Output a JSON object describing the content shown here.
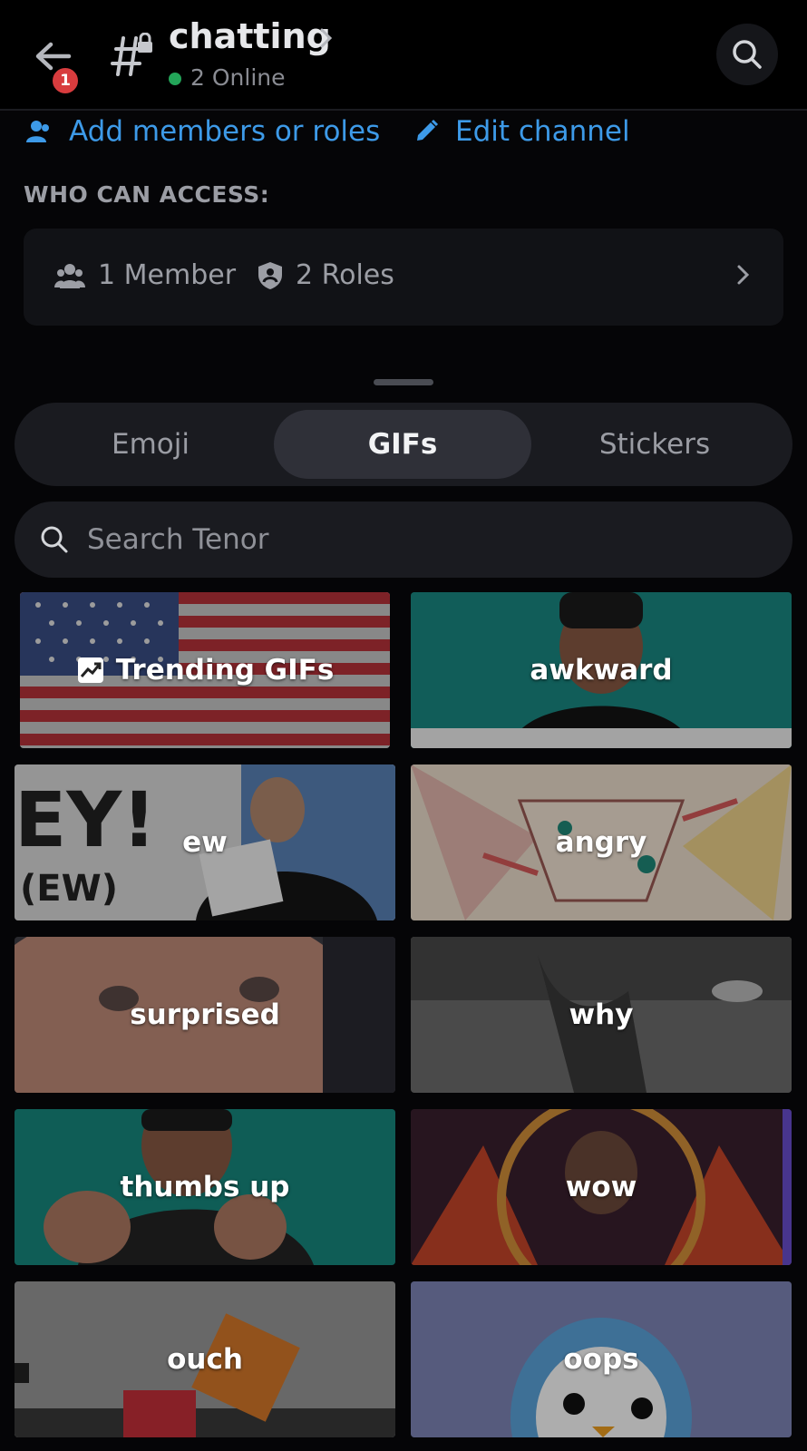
{
  "header": {
    "back_badge": "1",
    "channel_name": "chatting",
    "online_status": "2 Online"
  },
  "links": {
    "add_members": "Add members or roles",
    "edit_channel": "Edit channel"
  },
  "access": {
    "heading": "WHO CAN ACCESS:",
    "members": "1 Member",
    "roles": "2 Roles"
  },
  "picker": {
    "tabs": [
      "Emoji",
      "GIFs",
      "Stickers"
    ],
    "active_tab": "GIFs",
    "search_placeholder": "Search Tenor"
  },
  "gifs": [
    {
      "label": "Trending GIFs",
      "icon": "trending-icon"
    },
    {
      "label": "awkward"
    },
    {
      "label": "ew"
    },
    {
      "label": "angry"
    },
    {
      "label": "surprised"
    },
    {
      "label": "why"
    },
    {
      "label": "thumbs up"
    },
    {
      "label": "wow"
    },
    {
      "label": "ouch"
    },
    {
      "label": "oops"
    }
  ],
  "colors": {
    "accent_link": "#3d9ae8",
    "online": "#23a559",
    "badge": "#d83c3e"
  }
}
